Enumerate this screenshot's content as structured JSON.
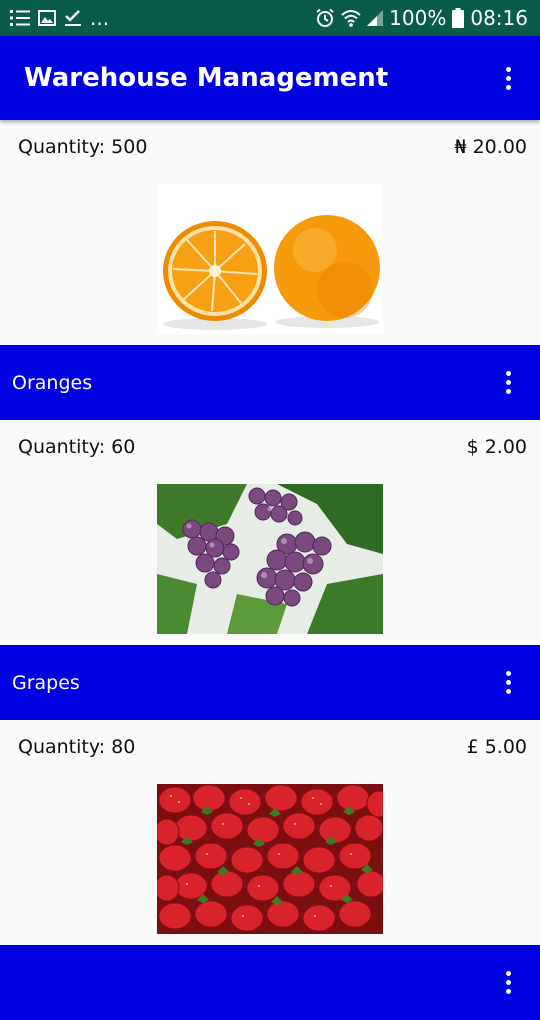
{
  "status_bar": {
    "notification_icons": [
      "list-icon",
      "image-icon",
      "check-icon"
    ],
    "overflow": "...",
    "battery": "100%",
    "time": "08:16",
    "background": "#0a5c4a"
  },
  "app_bar": {
    "title": "Warehouse Management",
    "menu_icon": "more-vert-icon",
    "color": "#0000e0"
  },
  "products": [
    {
      "quantity_label": "Quantity: 500",
      "price": "₦ 20.00",
      "name": "Oranges",
      "image": "oranges"
    },
    {
      "quantity_label": "Quantity: 60",
      "price": "$ 2.00",
      "name": "Grapes",
      "image": "grapes"
    },
    {
      "quantity_label": "Quantity: 80",
      "price": "£ 5.00",
      "name": "",
      "image": "strawberries"
    }
  ]
}
